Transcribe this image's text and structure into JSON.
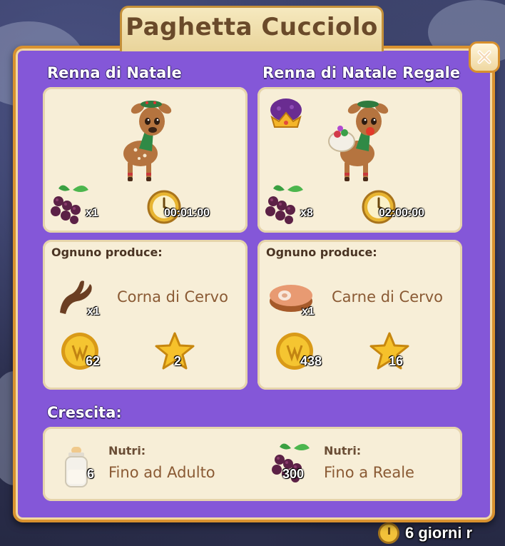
{
  "window": {
    "title": "Paghetta Cucciolo"
  },
  "animals": [
    {
      "name": "Renna di Natale",
      "feed_count": "x1",
      "timer": "00:01:00",
      "produces_label": "Ognuno produce:",
      "product": {
        "name": "Corna di Cervo",
        "count": "x1",
        "icon": "antler-icon"
      },
      "coins": "62",
      "xp": "2"
    },
    {
      "name": "Renna di Natale Regale",
      "feed_count": "x8",
      "timer": "02:00:00",
      "produces_label": "Ognuno produce:",
      "product": {
        "name": "Carne di Cervo",
        "count": "x1",
        "icon": "meat-icon"
      },
      "coins": "438",
      "xp": "16"
    }
  ],
  "growth": {
    "title": "Crescita:",
    "items": [
      {
        "nutri_label": "Nutri:",
        "count": "6",
        "goal": "Fino ad Adulto",
        "icon": "milk-bottle-icon"
      },
      {
        "nutri_label": "Nutri:",
        "count": "300",
        "goal": "Fino a Reale",
        "icon": "berries-icon"
      }
    ]
  },
  "background_timer": "6 giorni r",
  "colors": {
    "panel": "#8457d8",
    "border": "#d9922f",
    "card": "#f7eed7",
    "title": "#6a4a2a"
  }
}
